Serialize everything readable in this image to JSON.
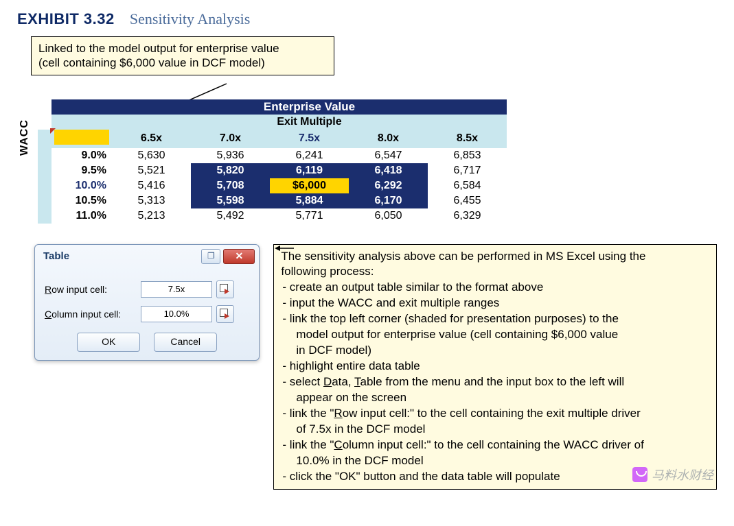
{
  "exhibit": {
    "number": "EXHIBIT 3.32",
    "title": "Sensitivity Analysis"
  },
  "callout_top": {
    "line1": "Linked to the model output for enterprise value",
    "line2": "(cell containing $6,000 value in DCF model)"
  },
  "table": {
    "title": "Enterprise Value",
    "subtitle": "Exit Multiple",
    "side_label": "WACC",
    "multiples": [
      "6.5x",
      "7.0x",
      "7.5x",
      "8.0x",
      "8.5x"
    ],
    "center_multiple_index": 2,
    "rows": [
      {
        "wacc": "9.0%",
        "values": [
          "5,630",
          "5,936",
          "6,241",
          "6,547",
          "6,853"
        ]
      },
      {
        "wacc": "9.5%",
        "values": [
          "5,521",
          "5,820",
          "6,119",
          "6,418",
          "6,717"
        ]
      },
      {
        "wacc": "10.0%",
        "values": [
          "5,416",
          "5,708",
          "$6,000",
          "6,292",
          "6,584"
        ],
        "center": true
      },
      {
        "wacc": "10.5%",
        "values": [
          "5,313",
          "5,598",
          "5,884",
          "6,170",
          "6,455"
        ]
      },
      {
        "wacc": "11.0%",
        "values": [
          "5,213",
          "5,492",
          "5,771",
          "6,050",
          "6,329"
        ]
      }
    ]
  },
  "dialog": {
    "title": "Table",
    "row_label": "Row input cell:",
    "row_underline": "R",
    "row_value": "7.5x",
    "col_label": "Column input cell:",
    "col_underline": "C",
    "col_value": "10.0%",
    "ok": "OK",
    "cancel": "Cancel",
    "close_glyph": "✕",
    "help_glyph": "❐"
  },
  "instructions": {
    "intro1": "The sensitivity analysis above can be performed in MS Excel using the",
    "intro2": "following process:",
    "items": [
      "- create an output table similar to the format above",
      "- input the WACC and exit multiple ranges",
      "- link the top left corner (shaded for presentation purposes) to the",
      "  model output for enterprise value (cell containing $6,000 value",
      "  in DCF model)",
      "- highlight entire data table",
      "- select Data, Table from the menu and the input box to the left will",
      "  appear on the screen",
      "- link the \"Row input cell:\" to the cell containing the exit multiple driver",
      "  of 7.5x in the DCF model",
      "- link the \"Column input cell:\" to the cell containing the WACC driver of",
      "  10.0% in the DCF model",
      "- click the \"OK\" button and the data table will populate"
    ]
  },
  "watermark": "马料水财经",
  "chart_data": {
    "type": "table",
    "title": "Enterprise Value — Sensitivity to WACC vs Exit Multiple",
    "x_label": "Exit Multiple",
    "y_label": "WACC",
    "x": [
      "6.5x",
      "7.0x",
      "7.5x",
      "8.0x",
      "8.5x"
    ],
    "y": [
      "9.0%",
      "9.5%",
      "10.0%",
      "10.5%",
      "11.0%"
    ],
    "values": [
      [
        5630,
        5936,
        6241,
        6547,
        6853
      ],
      [
        5521,
        5820,
        6119,
        6418,
        6717
      ],
      [
        5416,
        5708,
        6000,
        6292,
        6584
      ],
      [
        5313,
        5598,
        5884,
        6170,
        6455
      ],
      [
        5213,
        5492,
        5771,
        6050,
        6329
      ]
    ],
    "highlight": {
      "row": 2,
      "col": 2,
      "display": "$6,000"
    }
  }
}
